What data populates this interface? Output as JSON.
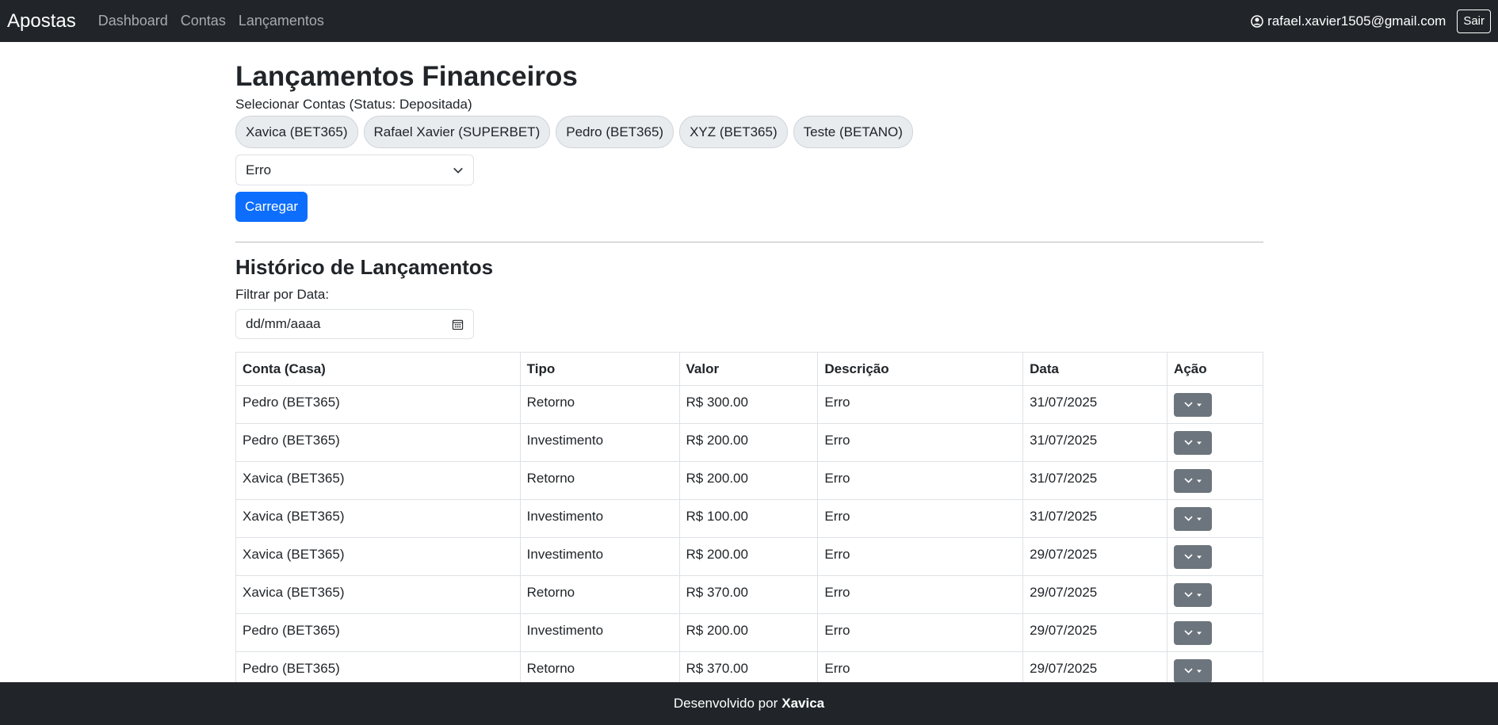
{
  "navbar": {
    "brand": "Apostas",
    "links": [
      "Dashboard",
      "Contas",
      "Lançamentos"
    ],
    "user_email": "rafael.xavier1505@gmail.com",
    "logout_label": "Sair"
  },
  "page": {
    "title": "Lançamentos Financeiros",
    "select_accounts_label": "Selecionar Contas (Status: Depositada)",
    "accounts": [
      "Xavica (BET365)",
      "Rafael Xavier (SUPERBET)",
      "Pedro (BET365)",
      "XYZ (BET365)",
      "Teste (BETANO)"
    ],
    "type_select_value": "Erro",
    "load_button": "Carregar"
  },
  "history": {
    "title": "Histórico de Lançamentos",
    "filter_label": "Filtrar por Data:",
    "date_placeholder": "dd/mm/aaaa",
    "columns": [
      "Conta (Casa)",
      "Tipo",
      "Valor",
      "Descrição",
      "Data",
      "Ação"
    ],
    "rows": [
      {
        "account": "Pedro (BET365)",
        "type": "Retorno",
        "value": "R$ 300.00",
        "description": "Erro",
        "date": "31/07/2025"
      },
      {
        "account": "Pedro (BET365)",
        "type": "Investimento",
        "value": "R$ 200.00",
        "description": "Erro",
        "date": "31/07/2025"
      },
      {
        "account": "Xavica (BET365)",
        "type": "Retorno",
        "value": "R$ 200.00",
        "description": "Erro",
        "date": "31/07/2025"
      },
      {
        "account": "Xavica (BET365)",
        "type": "Investimento",
        "value": "R$ 100.00",
        "description": "Erro",
        "date": "31/07/2025"
      },
      {
        "account": "Xavica (BET365)",
        "type": "Investimento",
        "value": "R$ 200.00",
        "description": "Erro",
        "date": "29/07/2025"
      },
      {
        "account": "Xavica (BET365)",
        "type": "Retorno",
        "value": "R$ 370.00",
        "description": "Erro",
        "date": "29/07/2025"
      },
      {
        "account": "Pedro (BET365)",
        "type": "Investimento",
        "value": "R$ 200.00",
        "description": "Erro",
        "date": "29/07/2025"
      },
      {
        "account": "Pedro (BET365)",
        "type": "Retorno",
        "value": "R$ 370.00",
        "description": "Erro",
        "date": "29/07/2025"
      }
    ]
  },
  "footer": {
    "text": "Desenvolvido por",
    "author": "Xavica"
  },
  "colors": {
    "navbar_bg": "#212529",
    "primary": "#0d6efd",
    "secondary": "#6c757d"
  }
}
